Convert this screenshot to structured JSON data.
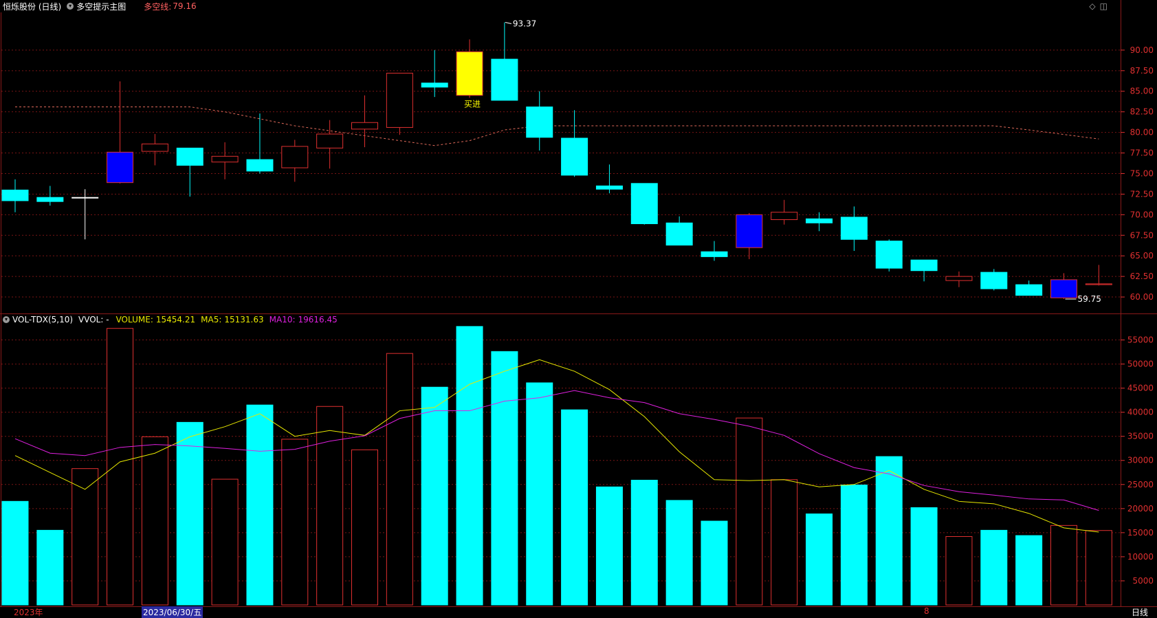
{
  "header": {
    "title": "恒烁股份 (日线)",
    "indicator_label": "多空提示主图",
    "line_label": "多空线:",
    "line_value": "79.16"
  },
  "volume_header": {
    "name": "VOL-TDX(5,10)",
    "vvol": "VVOL: -",
    "volume_label": "VOLUME:",
    "volume_value": "15454.21",
    "ma5_label": "MA5:",
    "ma5_value": "15131.63",
    "ma10_label": "MA10:",
    "ma10_value": "19616.45"
  },
  "annotations": {
    "high": "93.37",
    "low": "59.75",
    "buy": "买进"
  },
  "footer": {
    "year": "2023年",
    "date": "2023/06/30/五",
    "month": "8",
    "period": "日线"
  },
  "colors": {
    "up": "#e03030",
    "down": "#00ffff",
    "highlight_down": "#0000ff",
    "buy_fill": "#ffff00",
    "ma5": "#e8e800",
    "ma10": "#e020e0",
    "grid": "#7a1515"
  },
  "chart_data": [
    {
      "type": "candlestick",
      "title": "恒烁股份 (日线)",
      "ylim": [
        58.5,
        94
      ],
      "yticks": [
        "60.00",
        "62.50",
        "65.00",
        "67.50",
        "70.00",
        "72.50",
        "75.00",
        "77.50",
        "80.00",
        "82.50",
        "85.00",
        "87.50",
        "90.00"
      ],
      "candles": [
        {
          "o": 73.0,
          "h": 74.3,
          "l": 70.3,
          "c": 71.7,
          "style": "down"
        },
        {
          "o": 72.1,
          "h": 73.5,
          "l": 71.1,
          "c": 71.6,
          "style": "down"
        },
        {
          "o": 72.1,
          "h": 73.1,
          "l": 67.0,
          "c": 72.1,
          "style": "doji"
        },
        {
          "o": 73.9,
          "h": 86.2,
          "l": 73.8,
          "c": 77.6,
          "style": "up-highlight"
        },
        {
          "o": 77.7,
          "h": 79.8,
          "l": 76.0,
          "c": 78.6,
          "style": "up"
        },
        {
          "o": 78.1,
          "h": 78.1,
          "l": 72.2,
          "c": 76.0,
          "style": "down"
        },
        {
          "o": 76.4,
          "h": 78.8,
          "l": 74.3,
          "c": 77.1,
          "style": "up"
        },
        {
          "o": 76.7,
          "h": 82.3,
          "l": 75.0,
          "c": 75.3,
          "style": "down"
        },
        {
          "o": 75.7,
          "h": 79.1,
          "l": 74.0,
          "c": 78.3,
          "style": "up"
        },
        {
          "o": 78.1,
          "h": 81.5,
          "l": 75.6,
          "c": 79.8,
          "style": "up"
        },
        {
          "o": 80.4,
          "h": 84.5,
          "l": 78.2,
          "c": 81.2,
          "style": "up"
        },
        {
          "o": 80.6,
          "h": 80.9,
          "l": 79.7,
          "c": 87.2,
          "style": "up"
        },
        {
          "o": 86.0,
          "h": 90.0,
          "l": 84.3,
          "c": 85.5,
          "style": "down"
        },
        {
          "o": 89.8,
          "h": 91.3,
          "l": 84.2,
          "c": 84.5,
          "style": "buy-signal"
        },
        {
          "o": 88.9,
          "h": 93.37,
          "l": 83.9,
          "c": 83.9,
          "style": "down"
        },
        {
          "o": 83.1,
          "h": 85.0,
          "l": 77.8,
          "c": 79.4,
          "style": "down"
        },
        {
          "o": 79.3,
          "h": 82.7,
          "l": 74.6,
          "c": 74.8,
          "style": "down"
        },
        {
          "o": 73.5,
          "h": 76.1,
          "l": 72.6,
          "c": 73.1,
          "style": "down"
        },
        {
          "o": 73.8,
          "h": 73.8,
          "l": 68.8,
          "c": 68.9,
          "style": "down"
        },
        {
          "o": 69.0,
          "h": 69.8,
          "l": 66.3,
          "c": 66.3,
          "style": "down"
        },
        {
          "o": 65.5,
          "h": 66.8,
          "l": 64.4,
          "c": 64.9,
          "style": "down"
        },
        {
          "o": 66.0,
          "h": 70.2,
          "l": 64.6,
          "c": 70.0,
          "style": "up-highlight"
        },
        {
          "o": 69.4,
          "h": 71.8,
          "l": 68.8,
          "c": 70.3,
          "style": "up"
        },
        {
          "o": 69.5,
          "h": 70.3,
          "l": 68.0,
          "c": 69.0,
          "style": "down"
        },
        {
          "o": 69.7,
          "h": 71.0,
          "l": 65.6,
          "c": 67.0,
          "style": "down"
        },
        {
          "o": 66.8,
          "h": 67.0,
          "l": 63.1,
          "c": 63.5,
          "style": "down"
        },
        {
          "o": 64.5,
          "h": 64.5,
          "l": 61.9,
          "c": 63.2,
          "style": "down"
        },
        {
          "o": 62.0,
          "h": 63.1,
          "l": 61.2,
          "c": 62.5,
          "style": "up"
        },
        {
          "o": 63.0,
          "h": 63.4,
          "l": 60.8,
          "c": 61.0,
          "style": "down"
        },
        {
          "o": 61.5,
          "h": 62.0,
          "l": 60.2,
          "c": 60.2,
          "style": "down"
        },
        {
          "o": 59.9,
          "h": 62.9,
          "l": 59.75,
          "c": 62.1,
          "style": "up-highlight"
        },
        {
          "o": 61.5,
          "h": 63.9,
          "l": 61.4,
          "c": 61.6,
          "style": "up"
        }
      ],
      "trend_line": [
        [
          0,
          83.1
        ],
        [
          5,
          83.1
        ],
        [
          6,
          82.5
        ],
        [
          8,
          80.8
        ],
        [
          10,
          79.6
        ],
        [
          12,
          78.4
        ],
        [
          13,
          79.0
        ],
        [
          14,
          80.3
        ],
        [
          15,
          80.8
        ],
        [
          20,
          80.8
        ],
        [
          25,
          80.8
        ],
        [
          28,
          80.8
        ],
        [
          29,
          80.3
        ],
        [
          31,
          79.2
        ]
      ]
    },
    {
      "type": "bar",
      "title": "VOL-TDX(5,10)",
      "ylim": [
        0,
        58500
      ],
      "yticks": [
        "5000",
        "10000",
        "15000",
        "20000",
        "25000",
        "30000",
        "35000",
        "40000",
        "45000",
        "50000",
        "55000"
      ],
      "series": [
        {
          "name": "VOLUME",
          "values": [
            21500,
            15500,
            28300,
            57400,
            34900,
            37900,
            26100,
            41500,
            34400,
            41200,
            32200,
            52200,
            45200,
            57800,
            52600,
            46100,
            40500,
            24500,
            25900,
            21700,
            17400,
            38800,
            26000,
            18900,
            24900,
            30800,
            20200,
            14200,
            15500,
            14400,
            16500,
            15450
          ]
        },
        {
          "name": "MA5",
          "values": [
            31000,
            27500,
            24000,
            29700,
            31500,
            34900,
            37000,
            39700,
            35000,
            36200,
            35200,
            40300,
            41000,
            45800,
            48500,
            50900,
            48500,
            44700,
            39100,
            31800,
            26000,
            25800,
            26000,
            24500,
            25000,
            27900,
            24000,
            21500,
            21000,
            19000,
            16000,
            15130
          ]
        },
        {
          "name": "MA10",
          "values": [
            34500,
            31500,
            31000,
            32700,
            33300,
            33000,
            32500,
            31900,
            32300,
            34000,
            35100,
            38700,
            40300,
            40300,
            42300,
            43000,
            44500,
            43000,
            42000,
            39700,
            38500,
            37100,
            35200,
            31400,
            28500,
            27200,
            24800,
            23500,
            22800,
            22000,
            21800,
            19620
          ]
        }
      ]
    }
  ]
}
